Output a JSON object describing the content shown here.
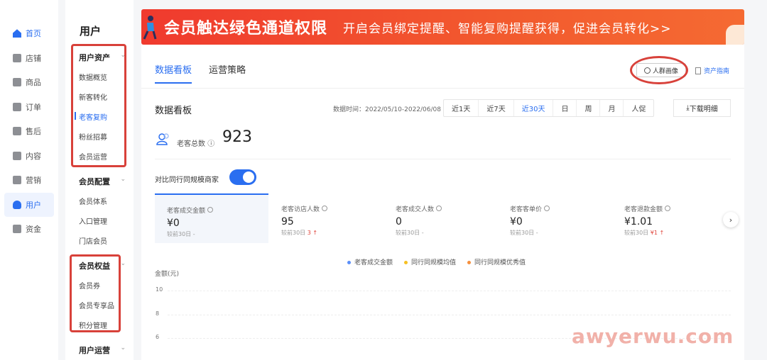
{
  "left_nav": {
    "items": [
      {
        "label": "首页",
        "icon": "home-icon"
      },
      {
        "label": "店铺",
        "icon": "shop-icon"
      },
      {
        "label": "商品",
        "icon": "goods-icon"
      },
      {
        "label": "订单",
        "icon": "order-icon"
      },
      {
        "label": "售后",
        "icon": "aftersale-icon"
      },
      {
        "label": "内容",
        "icon": "content-icon"
      },
      {
        "label": "营销",
        "icon": "marketing-icon"
      },
      {
        "label": "用户",
        "icon": "user-icon"
      },
      {
        "label": "资金",
        "icon": "funds-icon"
      }
    ],
    "active": "用户"
  },
  "sub_nav": {
    "title": "用户",
    "sections": [
      {
        "title": "用户资产",
        "items": [
          "数据概览",
          "新客转化",
          "老客复购",
          "粉丝招募",
          "会员运营"
        ]
      },
      {
        "title": "会员配置",
        "items": [
          "会员体系",
          "入口管理",
          "门店会员"
        ]
      },
      {
        "title": "会员权益",
        "items": [
          "会员券",
          "会员专享品",
          "积分管理"
        ]
      },
      {
        "title": "用户运营",
        "items": []
      }
    ],
    "active_item": "老客复购"
  },
  "banner": {
    "title": "会员触达绿色通道权限",
    "subtitle": "开启会员绑定提醒、智能复购提醒获得，促进会员转化>>"
  },
  "tabs": [
    "数据看板",
    "运营策略"
  ],
  "active_tab": "数据看板",
  "persona_button": "人群画像",
  "asset_guide": "资产指南",
  "board": {
    "title": "数据看板",
    "date_range": "数据时间：2022/05/10-2022/06/08",
    "ranges": [
      "近1天",
      "近7天",
      "近30天",
      "日",
      "周",
      "月",
      "人促"
    ],
    "active_range": "近30天",
    "download": "下载明细"
  },
  "total": {
    "label": "老客总数",
    "value": "923"
  },
  "compare_toggle": {
    "label": "对比同行同规模商家",
    "on": true
  },
  "metrics": [
    {
      "name": "老客成交金额",
      "value": "¥0",
      "compare": "较前30日",
      "delta": "-"
    },
    {
      "name": "老客访店人数",
      "value": "95",
      "compare": "较前30日",
      "delta": "3 ↑"
    },
    {
      "name": "老客成交人数",
      "value": "0",
      "compare": "较前30日",
      "delta": "-"
    },
    {
      "name": "老客客单价",
      "value": "¥0",
      "compare": "较前30日",
      "delta": "-"
    },
    {
      "name": "老客退款金额",
      "value": "¥1.01",
      "compare": "较前30日",
      "delta": "¥1 ↑"
    }
  ],
  "legend": [
    {
      "label": "老客成交金额",
      "color": "#5b8ff9"
    },
    {
      "label": "同行同规模均值",
      "color": "#f6c022"
    },
    {
      "label": "同行同规模优秀值",
      "color": "#f6903d"
    }
  ],
  "chart": {
    "ylabel": "金额(元)",
    "ticks": [
      "10",
      "8",
      "6"
    ]
  },
  "watermark": "awyerwu.com"
}
